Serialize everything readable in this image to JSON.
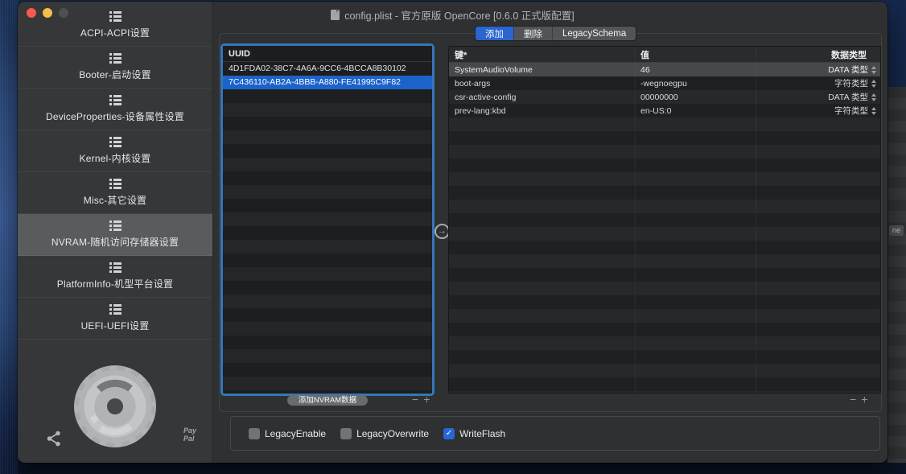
{
  "window": {
    "title": "config.plist - 官方原版 OpenCore [0.6.0 正式版配置]",
    "traffic_lights": [
      "close",
      "minimize",
      "zoom-disabled"
    ]
  },
  "sidebar": {
    "items": [
      {
        "label": "ACPI-ACPI设置",
        "selected": false
      },
      {
        "label": "Booter-启动设置",
        "selected": false
      },
      {
        "label": "DeviceProperties-设备属性设置",
        "selected": false
      },
      {
        "label": "Kernel-内核设置",
        "selected": false
      },
      {
        "label": "Misc-其它设置",
        "selected": false
      },
      {
        "label": "NVRAM-随机访问存储器设置",
        "selected": true
      },
      {
        "label": "PlatformInfo-机型平台设置",
        "selected": false
      },
      {
        "label": "UEFI-UEFI设置",
        "selected": false
      }
    ],
    "paypal": {
      "line1": "Pay",
      "line2": "Pal"
    }
  },
  "tabs": [
    {
      "label": "添加",
      "selected": true
    },
    {
      "label": "删除",
      "selected": false
    },
    {
      "label": "LegacySchema",
      "selected": false
    }
  ],
  "uuid_panel": {
    "header": "UUID",
    "rows": [
      {
        "value": "4D1FDA02-38C7-4A6A-9CC6-4BCCA8B30102",
        "selected": false
      },
      {
        "value": "7C436110-AB2A-4BBB-A880-FE41995C9F82",
        "selected": true
      }
    ],
    "add_button": "添加NVRAM数据"
  },
  "nvram_table": {
    "columns": [
      "键*",
      "值",
      "数据类型"
    ],
    "rows": [
      {
        "key": "SystemAudioVolume",
        "value": "46",
        "type": "DATA 类型",
        "selected": true
      },
      {
        "key": "boot-args",
        "value": "-wegnoegpu",
        "type": "字符类型",
        "selected": false
      },
      {
        "key": "csr-active-config",
        "value": "00000000",
        "type": "DATA 类型",
        "selected": false
      },
      {
        "key": "prev-lang:kbd",
        "value": "en-US:0",
        "type": "字符类型",
        "selected": false
      }
    ]
  },
  "footer": {
    "checkboxes": [
      {
        "label": "LegacyEnable",
        "checked": false
      },
      {
        "label": "LegacyOverwrite",
        "checked": false
      },
      {
        "label": "WriteFlash",
        "checked": true
      }
    ]
  },
  "controls": {
    "minus": "−",
    "plus": "+",
    "arrow": "→",
    "check_glyph": "✓"
  },
  "background_window": {
    "partial_label": "ne"
  },
  "colors": {
    "selection_blue": "#1c63c9",
    "tab_selected_blue": "#2a65d0",
    "checkbox_blue": "#2667d6",
    "focus_ring_blue": "#3577b8",
    "traffic_red": "#f7594f",
    "traffic_yellow": "#f5bd4b"
  }
}
